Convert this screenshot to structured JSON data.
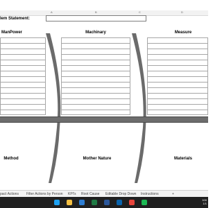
{
  "ruler": {
    "ticks": [
      "A",
      "B",
      "C",
      "D"
    ]
  },
  "problem": {
    "label": "lem Statement:",
    "value": ""
  },
  "categories": {
    "top": [
      "ManPower",
      "Machinary",
      "Measure"
    ],
    "bottom": [
      "Method",
      "Mother Nature",
      "Materials"
    ]
  },
  "tabs": [
    "pact Actions",
    "Filter Actions by Person",
    "KPI's",
    "Root Cause",
    "Editable Drop Down",
    "Instructions",
    "+"
  ],
  "taskbar": {
    "icons": [
      "edge-icon",
      "files-icon",
      "store-icon",
      "excel-icon",
      "word-icon",
      "outlook-icon",
      "chrome-icon",
      "spotify-icon"
    ],
    "colors": [
      "#1da1f2",
      "#f5c042",
      "#2d7dd2",
      "#1f7a44",
      "#2b579a",
      "#0a64ad",
      "#e8453c",
      "#1db954"
    ],
    "clock": "100",
    "date": "1/1"
  }
}
